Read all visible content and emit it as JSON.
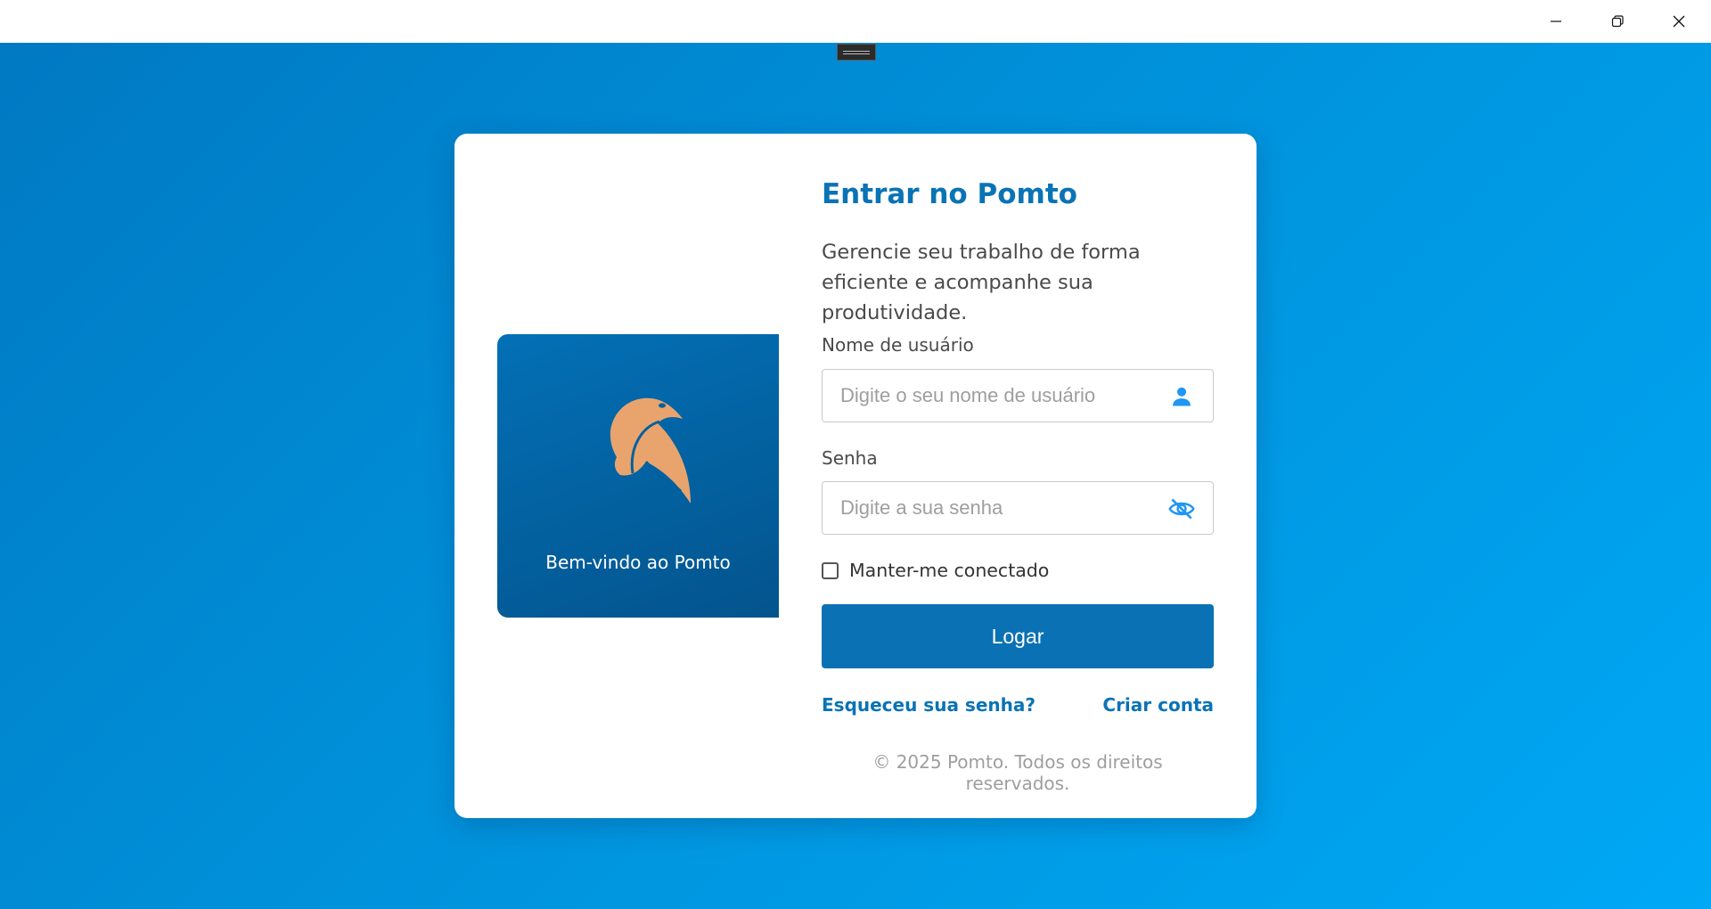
{
  "window": {
    "minimize_icon": "minimize-icon",
    "maximize_icon": "restore-icon",
    "close_icon": "close-icon"
  },
  "welcome": {
    "text": "Bem-vindo ao Pomto",
    "logo_icon": "bird-logo"
  },
  "form": {
    "title": "Entrar no Pomto",
    "subtitle": "Gerencie seu trabalho de forma eficiente e acompanhe sua produtividade.",
    "username": {
      "label": "Nome de usuário",
      "placeholder": "Digite o seu nome de usuário",
      "value": "",
      "icon": "user-icon"
    },
    "password": {
      "label": "Senha",
      "placeholder": "Digite a sua senha",
      "value": "",
      "icon": "eye-slash-icon"
    },
    "remember": {
      "label": "Manter-me conectado",
      "checked": false
    },
    "login_button": "Logar",
    "forgot_link": "Esqueceu sua senha?",
    "create_link": "Criar conta",
    "footer": "© 2025 Pomto. Todos os direitos reservados."
  },
  "colors": {
    "accent": "#0A73B5",
    "icon_blue": "#2196F3",
    "logo": "#E9A46E"
  }
}
